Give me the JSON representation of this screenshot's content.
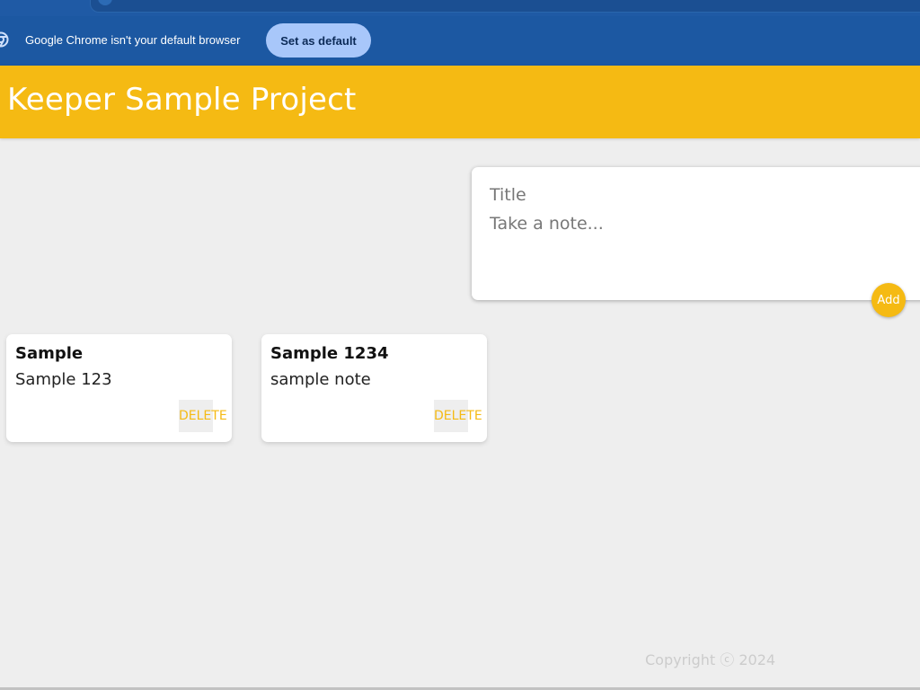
{
  "infobar": {
    "message": "Google Chrome isn't your default browser",
    "button_label": "Set as default",
    "icon": "chrome-icon"
  },
  "header": {
    "title": "Keeper Sample Project"
  },
  "create_note": {
    "title_placeholder": "Title",
    "content_placeholder": "Take a note...",
    "add_label": "Add"
  },
  "notes": [
    {
      "title": "Sample",
      "content": "Sample 123",
      "delete_label": "DELETE"
    },
    {
      "title": "Sample 1234",
      "content": "sample note",
      "delete_label": "DELETE"
    }
  ],
  "footer": {
    "copyright": "Copyright ⓒ 2024"
  },
  "colors": {
    "accent": "#f5ba13",
    "page_background": "#eeeeee",
    "infobar_background": "#1c58a2",
    "infobar_button": "#a8c7fa"
  }
}
